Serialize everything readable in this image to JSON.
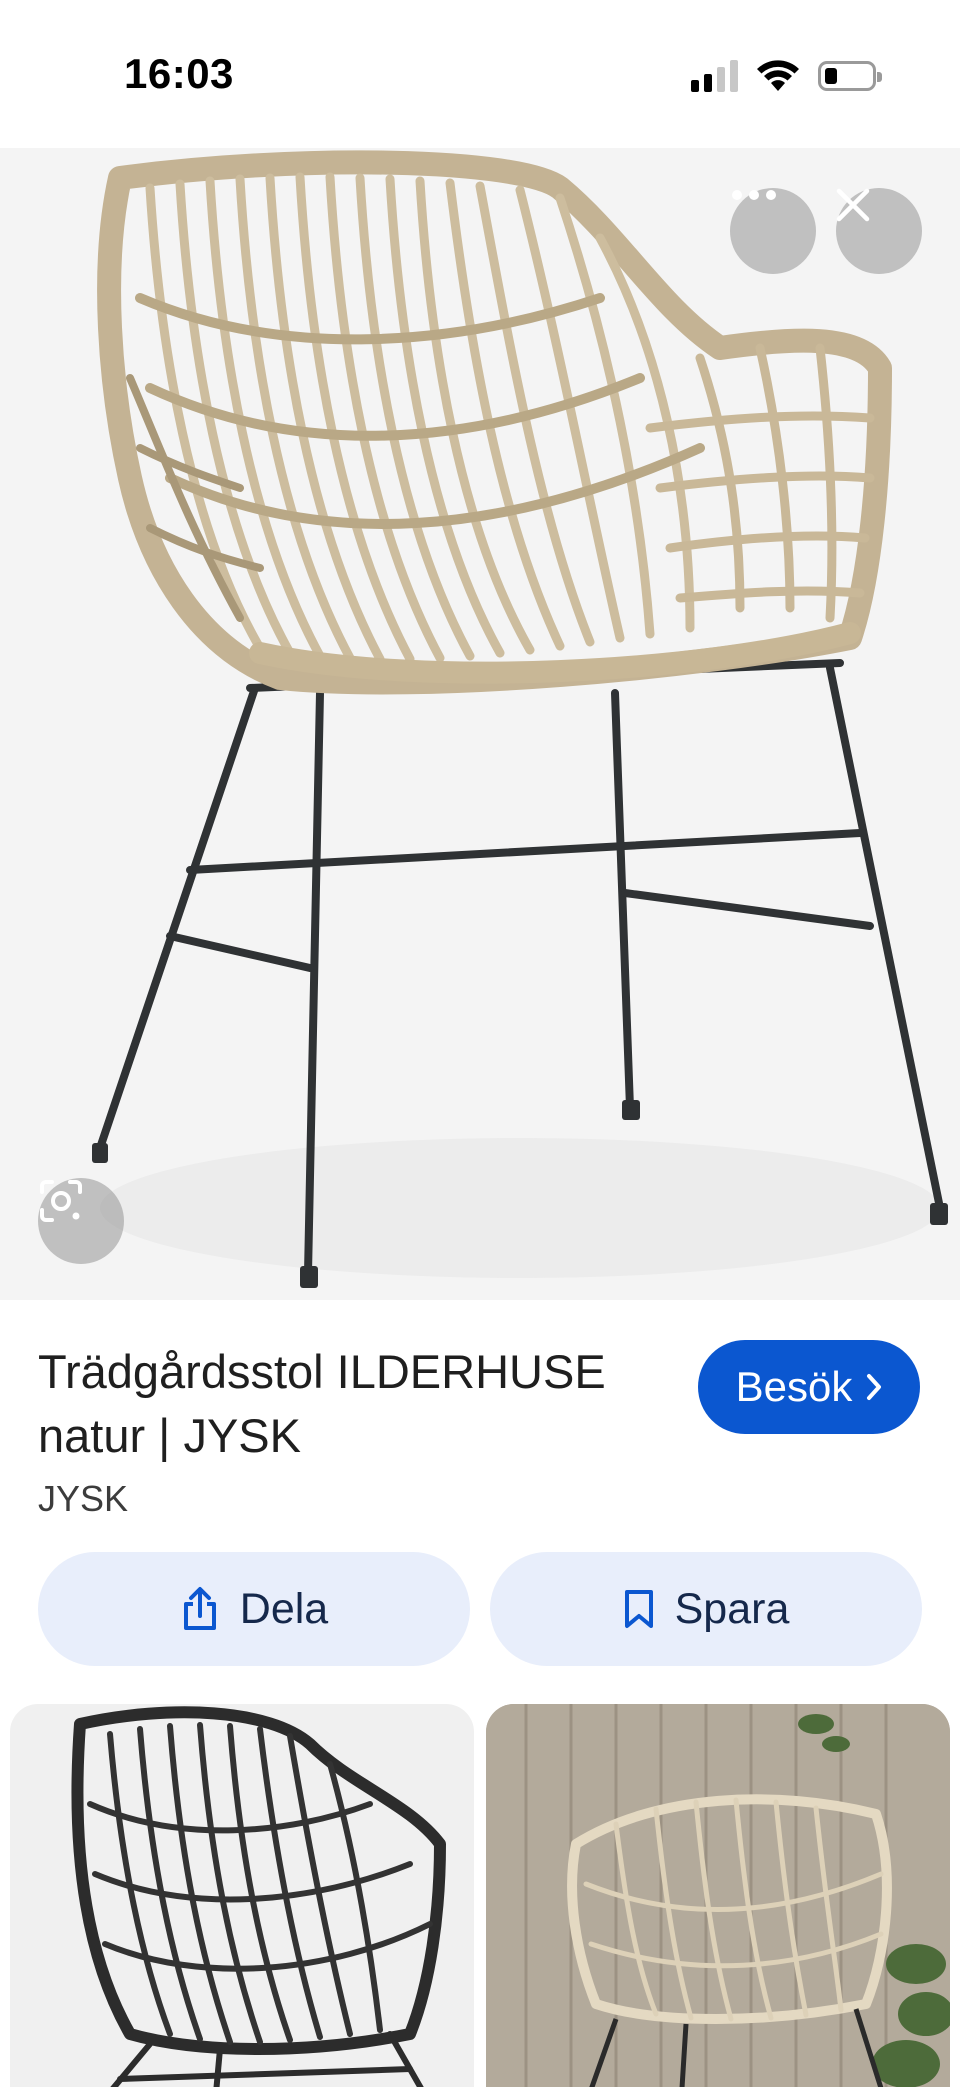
{
  "status_bar": {
    "time": "16:03",
    "icons": [
      "signal-icon",
      "wifi-icon",
      "battery-icon"
    ]
  },
  "hero": {
    "image_description_icon": "chair-image",
    "buttons": {
      "more": "more-icon",
      "close": "close-icon",
      "lens": "lens-icon"
    }
  },
  "result": {
    "title": "Trädgårdsstol ILDERHUSE natur | JYSK",
    "source": "JYSK",
    "visit_label": "Besök",
    "share_label": "Dela",
    "save_label": "Spara"
  },
  "colors": {
    "accent": "#0b57d0",
    "chip_bg": "#e8eefb"
  }
}
